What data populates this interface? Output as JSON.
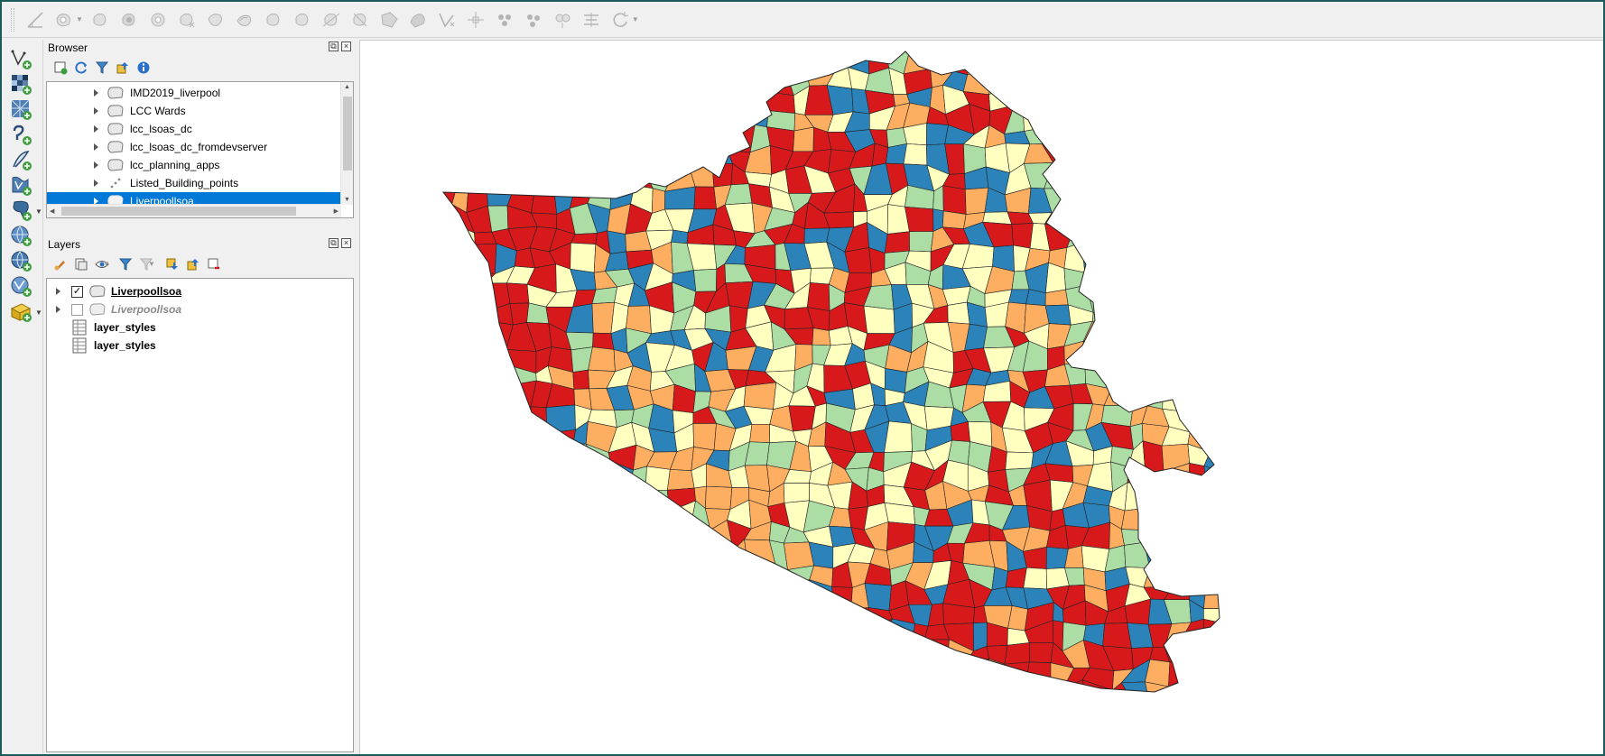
{
  "browser": {
    "title": "Browser",
    "items": [
      {
        "label": "IMD2019_liverpool",
        "icon": "polygon-layer-icon"
      },
      {
        "label": "LCC Wards",
        "icon": "polygon-layer-icon"
      },
      {
        "label": "lcc_lsoas_dc",
        "icon": "polygon-layer-icon"
      },
      {
        "label": "lcc_lsoas_dc_fromdevserver",
        "icon": "polygon-layer-icon"
      },
      {
        "label": "lcc_planning_apps",
        "icon": "polygon-layer-icon"
      },
      {
        "label": "Listed_Building_points",
        "icon": "point-layer-icon"
      },
      {
        "label": "Liverpoollsoa",
        "icon": "polygon-layer-icon",
        "selected": true
      }
    ]
  },
  "layers": {
    "title": "Layers",
    "items": [
      {
        "label": "Liverpoollsoa",
        "checked": true,
        "type": "polygon"
      },
      {
        "label": "Liverpoollsoa",
        "checked": false,
        "type": "polygon"
      },
      {
        "label": "layer_styles",
        "type": "table"
      },
      {
        "label": "layer_styles",
        "type": "table"
      }
    ]
  },
  "map": {
    "palette": [
      "#d7191c",
      "#fdae61",
      "#ffffbf",
      "#abdda4",
      "#2b83ba"
    ],
    "outline_color": "#232323"
  },
  "colors": {
    "selection": "#0078d7",
    "panel_bg": "#f0f0f0",
    "window_border": "#1d5a5a"
  }
}
